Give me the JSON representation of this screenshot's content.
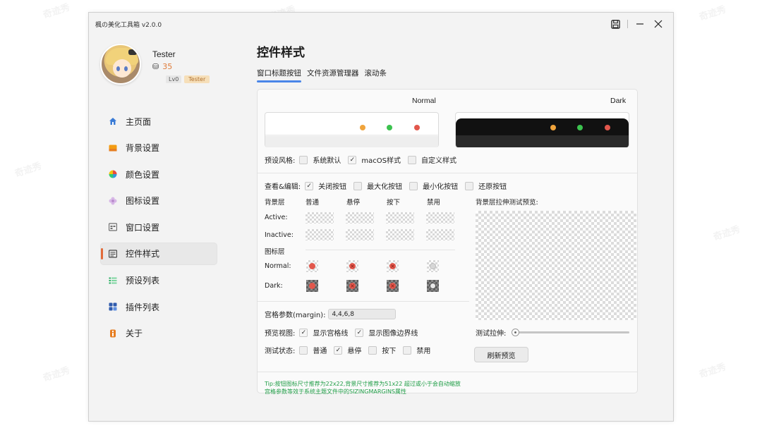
{
  "window": {
    "title": "楓の美化工具箱 v2.0.0",
    "controls": [
      "save-icon",
      "minimize-icon",
      "close-icon"
    ]
  },
  "profile": {
    "name": "Tester",
    "coins": "35",
    "level": "Lv0",
    "role": "Tester"
  },
  "sidebar": {
    "items": [
      {
        "label": "主页面",
        "icon": "home-icon",
        "color": "#3a7bd5"
      },
      {
        "label": "背景设置",
        "icon": "image-icon",
        "color": "#f39c12"
      },
      {
        "label": "颜色设置",
        "icon": "palette-icon",
        "color": "#e74c3c"
      },
      {
        "label": "图标设置",
        "icon": "flower-icon",
        "color": "#c39bd3"
      },
      {
        "label": "窗口设置",
        "icon": "window-icon",
        "color": "#7f8c8d"
      },
      {
        "label": "控件样式",
        "icon": "control-icon",
        "color": "#555555"
      },
      {
        "label": "预设列表",
        "icon": "list-icon",
        "color": "#27ae60"
      },
      {
        "label": "插件列表",
        "icon": "plugin-icon",
        "color": "#2e5aac"
      },
      {
        "label": "关于",
        "icon": "info-icon",
        "color": "#e67e22"
      }
    ],
    "active_index": 5
  },
  "page": {
    "title": "控件样式",
    "tabs": [
      "窗口标题按钮",
      "文件资源管理器",
      "滚动条"
    ],
    "active_tab": 0
  },
  "preview": {
    "normal_label": "Normal",
    "dark_label": "Dark",
    "traffic_colors": [
      "#f0a43c",
      "#3cc24f",
      "#e2574c"
    ]
  },
  "preset_style": {
    "label": "预设风格:",
    "options": [
      {
        "label": "系统默认",
        "checked": false
      },
      {
        "label": "macOS样式",
        "checked": true
      },
      {
        "label": "自定义样式",
        "checked": false
      }
    ]
  },
  "view_edit": {
    "label": "查看&编辑:",
    "options": [
      {
        "label": "关闭按钮",
        "checked": true
      },
      {
        "label": "最大化按钮",
        "checked": false
      },
      {
        "label": "最小化按钮",
        "checked": false
      },
      {
        "label": "还原按钮",
        "checked": false
      }
    ]
  },
  "grid": {
    "bg_layer_label": "背景层",
    "states": [
      "普通",
      "悬停",
      "按下",
      "禁用"
    ],
    "rows_bg": [
      "Active:",
      "Inactive:"
    ],
    "icon_layer_label": "图标层",
    "rows_icon": [
      "Normal:",
      "Dark:"
    ]
  },
  "stretch_preview_label": "背景层拉伸测试预览:",
  "margin": {
    "label": "宫格参数(margin):",
    "value": "4,4,6,8"
  },
  "preview_view": {
    "label": "预览视图:",
    "options": [
      {
        "label": "显示宫格线",
        "checked": true
      },
      {
        "label": "显示图像边界线",
        "checked": true
      }
    ]
  },
  "stretch_test": {
    "label": "测试拉伸:",
    "value": 0
  },
  "test_state": {
    "label": "测试状态:",
    "options": [
      {
        "label": "普通",
        "checked": false
      },
      {
        "label": "悬停",
        "checked": true
      },
      {
        "label": "按下",
        "checked": false
      },
      {
        "label": "禁用",
        "checked": false
      }
    ]
  },
  "refresh_button": "刷新预览",
  "tip": {
    "line1": "Tip:按钮图标尺寸推荐为22x22,背景尺寸推荐为51x22 超过或小于会自动缩放",
    "line2": "宫格参数等效于系统主题文件中的SIZINGMARGINS属性"
  }
}
